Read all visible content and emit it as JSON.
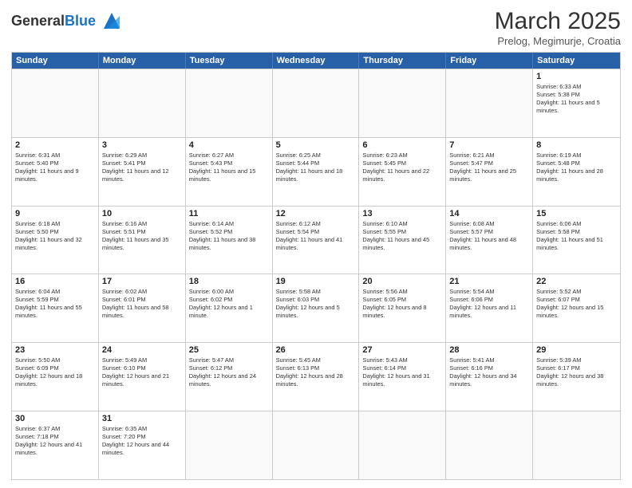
{
  "logo": {
    "general": "General",
    "blue": "Blue"
  },
  "title": {
    "month_year": "March 2025",
    "location": "Prelog, Megimurje, Croatia"
  },
  "header_days": [
    "Sunday",
    "Monday",
    "Tuesday",
    "Wednesday",
    "Thursday",
    "Friday",
    "Saturday"
  ],
  "rows": [
    [
      {
        "day": "",
        "sun": ""
      },
      {
        "day": "",
        "sun": ""
      },
      {
        "day": "",
        "sun": ""
      },
      {
        "day": "",
        "sun": ""
      },
      {
        "day": "",
        "sun": ""
      },
      {
        "day": "",
        "sun": ""
      },
      {
        "day": "1",
        "sun": "Sunrise: 6:33 AM\nSunset: 5:38 PM\nDaylight: 11 hours and 5 minutes."
      }
    ],
    [
      {
        "day": "2",
        "sun": "Sunrise: 6:31 AM\nSunset: 5:40 PM\nDaylight: 11 hours and 9 minutes."
      },
      {
        "day": "3",
        "sun": "Sunrise: 6:29 AM\nSunset: 5:41 PM\nDaylight: 11 hours and 12 minutes."
      },
      {
        "day": "4",
        "sun": "Sunrise: 6:27 AM\nSunset: 5:43 PM\nDaylight: 11 hours and 15 minutes."
      },
      {
        "day": "5",
        "sun": "Sunrise: 6:25 AM\nSunset: 5:44 PM\nDaylight: 11 hours and 18 minutes."
      },
      {
        "day": "6",
        "sun": "Sunrise: 6:23 AM\nSunset: 5:45 PM\nDaylight: 11 hours and 22 minutes."
      },
      {
        "day": "7",
        "sun": "Sunrise: 6:21 AM\nSunset: 5:47 PM\nDaylight: 11 hours and 25 minutes."
      },
      {
        "day": "8",
        "sun": "Sunrise: 6:19 AM\nSunset: 5:48 PM\nDaylight: 11 hours and 28 minutes."
      }
    ],
    [
      {
        "day": "9",
        "sun": "Sunrise: 6:18 AM\nSunset: 5:50 PM\nDaylight: 11 hours and 32 minutes."
      },
      {
        "day": "10",
        "sun": "Sunrise: 6:16 AM\nSunset: 5:51 PM\nDaylight: 11 hours and 35 minutes."
      },
      {
        "day": "11",
        "sun": "Sunrise: 6:14 AM\nSunset: 5:52 PM\nDaylight: 11 hours and 38 minutes."
      },
      {
        "day": "12",
        "sun": "Sunrise: 6:12 AM\nSunset: 5:54 PM\nDaylight: 11 hours and 41 minutes."
      },
      {
        "day": "13",
        "sun": "Sunrise: 6:10 AM\nSunset: 5:55 PM\nDaylight: 11 hours and 45 minutes."
      },
      {
        "day": "14",
        "sun": "Sunrise: 6:08 AM\nSunset: 5:57 PM\nDaylight: 11 hours and 48 minutes."
      },
      {
        "day": "15",
        "sun": "Sunrise: 6:06 AM\nSunset: 5:58 PM\nDaylight: 11 hours and 51 minutes."
      }
    ],
    [
      {
        "day": "16",
        "sun": "Sunrise: 6:04 AM\nSunset: 5:59 PM\nDaylight: 11 hours and 55 minutes."
      },
      {
        "day": "17",
        "sun": "Sunrise: 6:02 AM\nSunset: 6:01 PM\nDaylight: 11 hours and 58 minutes."
      },
      {
        "day": "18",
        "sun": "Sunrise: 6:00 AM\nSunset: 6:02 PM\nDaylight: 12 hours and 1 minute."
      },
      {
        "day": "19",
        "sun": "Sunrise: 5:58 AM\nSunset: 6:03 PM\nDaylight: 12 hours and 5 minutes."
      },
      {
        "day": "20",
        "sun": "Sunrise: 5:56 AM\nSunset: 6:05 PM\nDaylight: 12 hours and 8 minutes."
      },
      {
        "day": "21",
        "sun": "Sunrise: 5:54 AM\nSunset: 6:06 PM\nDaylight: 12 hours and 11 minutes."
      },
      {
        "day": "22",
        "sun": "Sunrise: 5:52 AM\nSunset: 6:07 PM\nDaylight: 12 hours and 15 minutes."
      }
    ],
    [
      {
        "day": "23",
        "sun": "Sunrise: 5:50 AM\nSunset: 6:09 PM\nDaylight: 12 hours and 18 minutes."
      },
      {
        "day": "24",
        "sun": "Sunrise: 5:49 AM\nSunset: 6:10 PM\nDaylight: 12 hours and 21 minutes."
      },
      {
        "day": "25",
        "sun": "Sunrise: 5:47 AM\nSunset: 6:12 PM\nDaylight: 12 hours and 24 minutes."
      },
      {
        "day": "26",
        "sun": "Sunrise: 5:45 AM\nSunset: 6:13 PM\nDaylight: 12 hours and 28 minutes."
      },
      {
        "day": "27",
        "sun": "Sunrise: 5:43 AM\nSunset: 6:14 PM\nDaylight: 12 hours and 31 minutes."
      },
      {
        "day": "28",
        "sun": "Sunrise: 5:41 AM\nSunset: 6:16 PM\nDaylight: 12 hours and 34 minutes."
      },
      {
        "day": "29",
        "sun": "Sunrise: 5:39 AM\nSunset: 6:17 PM\nDaylight: 12 hours and 38 minutes."
      }
    ],
    [
      {
        "day": "30",
        "sun": "Sunrise: 6:37 AM\nSunset: 7:18 PM\nDaylight: 12 hours and 41 minutes."
      },
      {
        "day": "31",
        "sun": "Sunrise: 6:35 AM\nSunset: 7:20 PM\nDaylight: 12 hours and 44 minutes."
      },
      {
        "day": "",
        "sun": ""
      },
      {
        "day": "",
        "sun": ""
      },
      {
        "day": "",
        "sun": ""
      },
      {
        "day": "",
        "sun": ""
      },
      {
        "day": "",
        "sun": ""
      }
    ]
  ]
}
